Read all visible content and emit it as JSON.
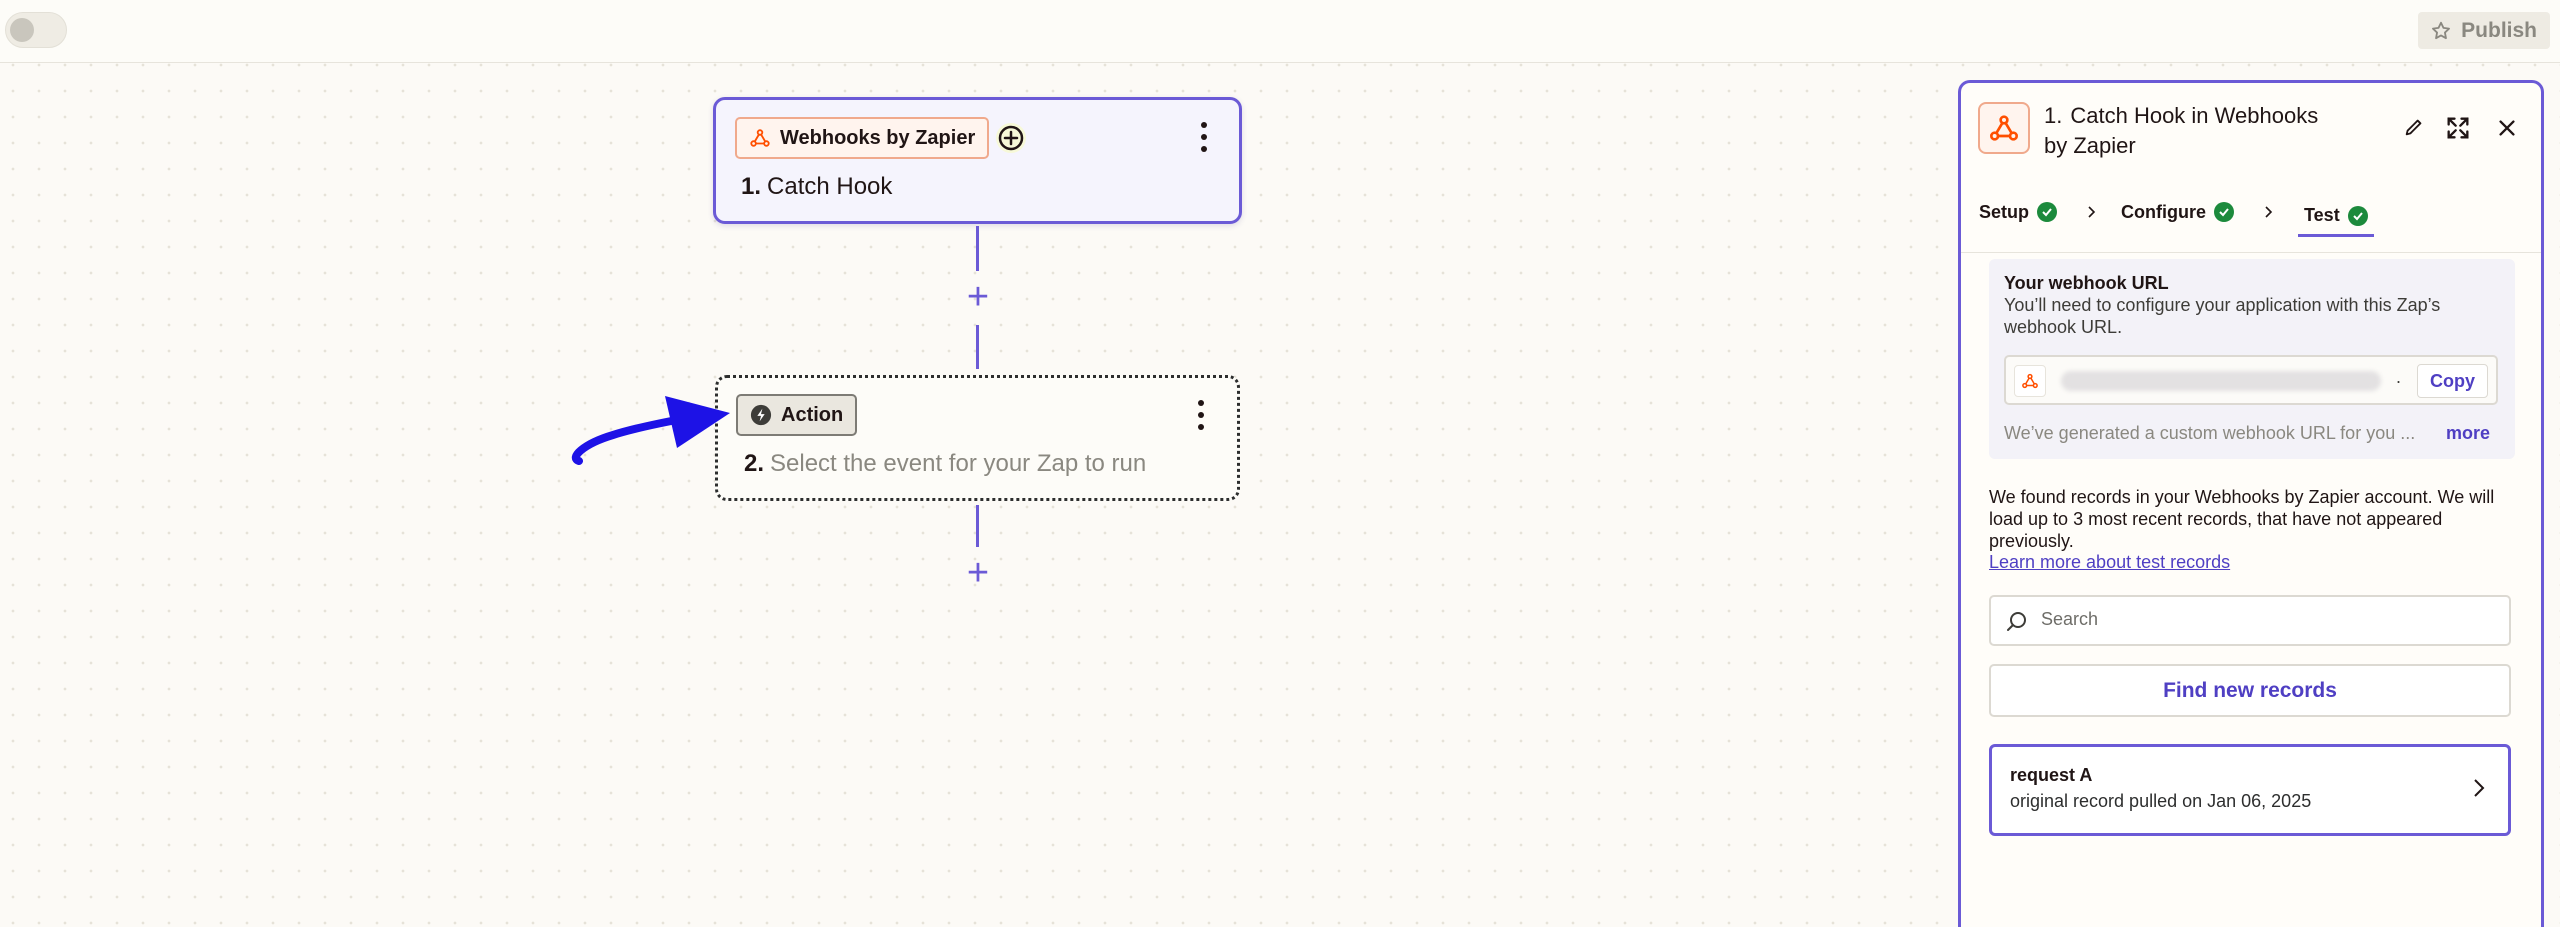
{
  "topbar": {
    "publish_label": "Publish",
    "publish_icon": "star-icon"
  },
  "canvas": {
    "trigger": {
      "app_name": "Webhooks by Zapier",
      "step_number": "1.",
      "step_title": "Catch Hook"
    },
    "action": {
      "app_name": "Action",
      "step_number": "2.",
      "step_title": "Select the event for your Zap to run"
    }
  },
  "panel": {
    "step_number": "1.",
    "title": "Catch Hook in Webhooks by Zapier",
    "tabs": [
      {
        "label": "Setup",
        "status": "complete"
      },
      {
        "label": "Configure",
        "status": "complete"
      },
      {
        "label": "Test",
        "status": "complete",
        "active": true
      }
    ],
    "webhook": {
      "label": "Your webhook URL",
      "description": "You’ll need to configure your application with this Zap’s webhook URL.",
      "url_suffix": ".",
      "copy_label": "Copy",
      "note": "We’ve generated a custom webhook URL for you ...",
      "more_label": "more"
    },
    "found_text": "We found records in your Webhooks by Zapier account. We will load up to 3 most recent records, that have not appeared previously.",
    "learn_link": "Learn more about test records",
    "search": {
      "placeholder": "Search",
      "value": ""
    },
    "find_button": "Find new records",
    "record": {
      "title": "request A",
      "subtitle": "original record pulled on Jan 06, 2025"
    }
  },
  "colors": {
    "accent": "#6b5ad6",
    "link": "#4f3fc3",
    "success": "#1c8a3c",
    "zapier_orange": "#ff4f00",
    "annotation_arrow": "#1d12e6"
  }
}
